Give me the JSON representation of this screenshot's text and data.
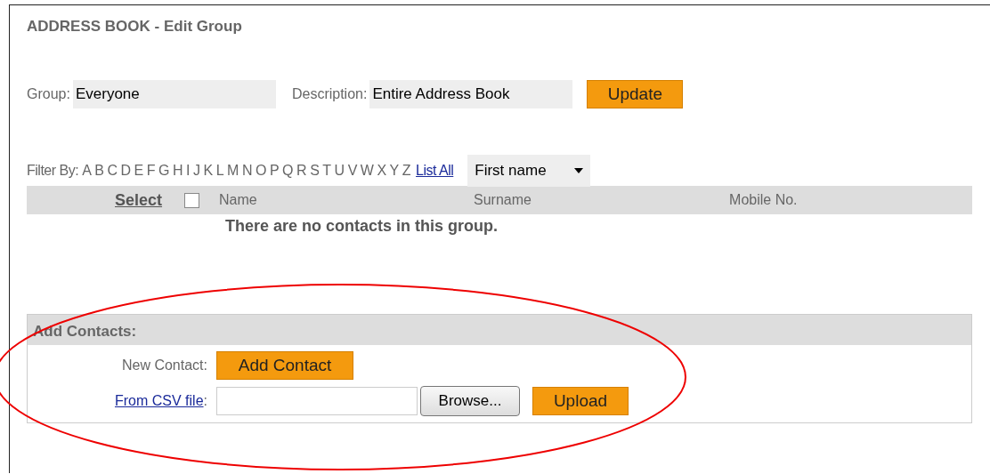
{
  "title": "ADDRESS BOOK - Edit Group",
  "group": {
    "label": "Group:",
    "value": "Everyone"
  },
  "description": {
    "label": "Description:",
    "value": "Entire Address Book"
  },
  "update_button": "Update",
  "filter": {
    "label": "Filter By:",
    "letters": [
      "A",
      "B",
      "C",
      "D",
      "E",
      "F",
      "G",
      "H",
      "I",
      "J",
      "K",
      "L",
      "M",
      "N",
      "O",
      "P",
      "Q",
      "R",
      "S",
      "T",
      "U",
      "V",
      "W",
      "X",
      "Y",
      "Z"
    ],
    "list_all": "List All",
    "sort_by": "First name"
  },
  "table": {
    "select_link": "Select",
    "select_all_checked": false,
    "columns": [
      "Name",
      "Surname",
      "Mobile No."
    ],
    "empty_message": "There are no contacts in this group."
  },
  "add_contacts": {
    "heading": "Add Contacts:",
    "new_contact_label": "New Contact:",
    "add_contact_button": "Add Contact",
    "csv_link": "From CSV file",
    "csv_colon": ":",
    "browse_button": "Browse...",
    "upload_button": "Upload"
  }
}
